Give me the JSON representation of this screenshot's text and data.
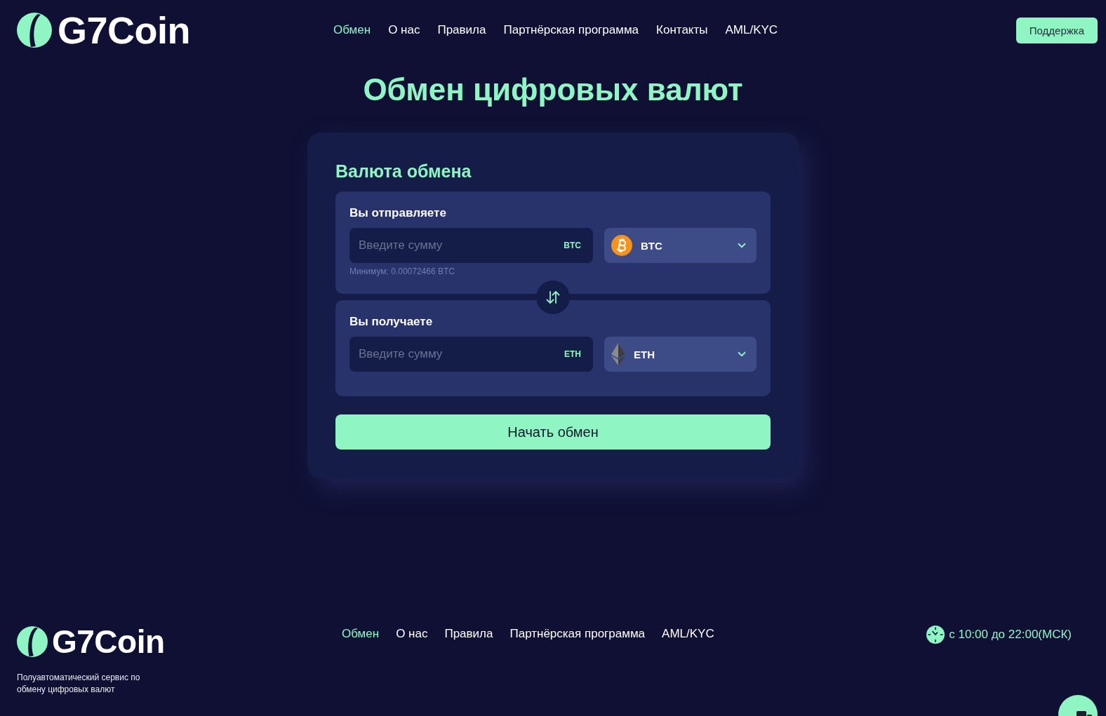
{
  "header": {
    "logo": "G7Coin",
    "nav": [
      {
        "label": "Обмен",
        "selected": true
      },
      {
        "label": "О нас",
        "selected": false
      },
      {
        "label": "Правила",
        "selected": false
      },
      {
        "label": "Партнёрская программа",
        "selected": false
      },
      {
        "label": "Контакты",
        "selected": false
      },
      {
        "label": "AML/KYC",
        "selected": false
      }
    ],
    "support_button": "Поддержка"
  },
  "page_title": "Обмен цифровых валют",
  "exchange_card": {
    "title": "Валюта обмена",
    "panels": [
      {
        "label": "Вы отправляете",
        "amount": {
          "placeholder": "Введите сумму",
          "unit": "BTC"
        },
        "currency": "BTC",
        "minimum": "Минимум: 0.00072466 BTC"
      },
      {
        "label": "Вы получаете",
        "amount": {
          "placeholder": "Введите сумму",
          "unit": "ETH"
        },
        "currency": "ETH"
      }
    ],
    "submit_button": "Начать обмен"
  },
  "footer": {
    "logo": "G7Coin",
    "tagline": "Полуавтоматический сервис по обмену цифровых валют",
    "nav": [
      {
        "label": "Обмен",
        "selected": true
      },
      {
        "label": "О нас",
        "selected": false
      },
      {
        "label": "Правила",
        "selected": false
      },
      {
        "label": "Партнёрская программа",
        "selected": false
      },
      {
        "label": "AML/KYC",
        "selected": false
      }
    ],
    "hours": "с 10:00 до 22:00(МСК)"
  }
}
